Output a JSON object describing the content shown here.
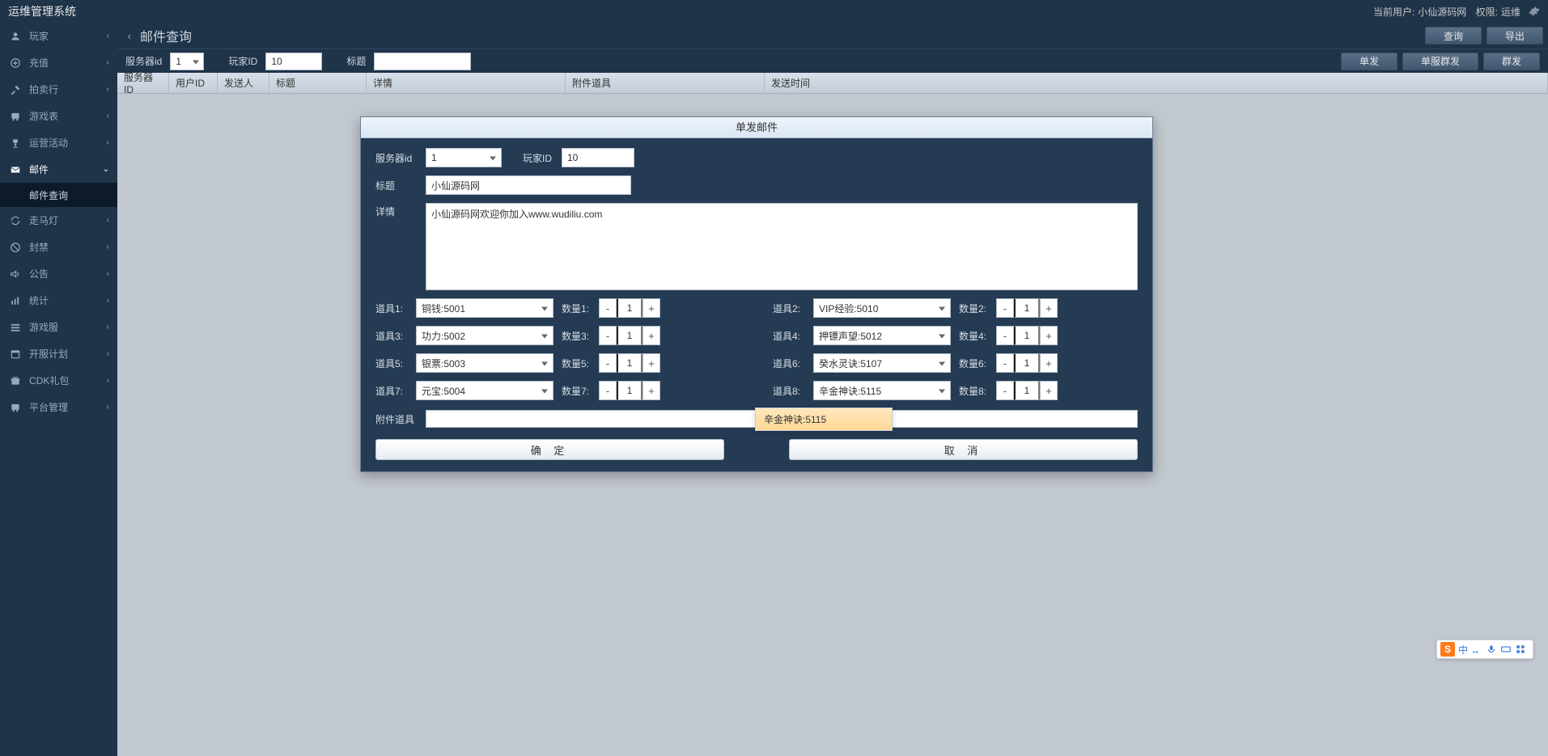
{
  "app": {
    "title": "运维管理系统"
  },
  "user": {
    "prefix": "当前用户:",
    "name": "小仙源码网",
    "role_prefix": "权限:",
    "role": "运维"
  },
  "sidebar": {
    "items": [
      {
        "label": "玩家",
        "icon": "user"
      },
      {
        "label": "充值",
        "icon": "gift"
      },
      {
        "label": "拍卖行",
        "icon": "hammer"
      },
      {
        "label": "游戏表",
        "icon": "bus"
      },
      {
        "label": "运营活动",
        "icon": "trophy"
      },
      {
        "label": "邮件",
        "icon": "mail",
        "expanded": true,
        "children": [
          {
            "label": "邮件查询"
          }
        ]
      },
      {
        "label": "走马灯",
        "icon": "refresh"
      },
      {
        "label": "封禁",
        "icon": "ban"
      },
      {
        "label": "公告",
        "icon": "horn"
      },
      {
        "label": "统计",
        "icon": "chart"
      },
      {
        "label": "游戏服",
        "icon": "list"
      },
      {
        "label": "开服计划",
        "icon": "calendar"
      },
      {
        "label": "CDK礼包",
        "icon": "gift2"
      },
      {
        "label": "平台管理",
        "icon": "bus"
      }
    ]
  },
  "page": {
    "title": "邮件查询",
    "actions_row1": {
      "query": "查询",
      "export": "导出"
    },
    "actions_row2": {
      "single": "单发",
      "server_single": "单服群发",
      "mass": "群发"
    },
    "filters": {
      "server_label": "服务器id",
      "server_value": "1",
      "player_label": "玩家ID",
      "player_value": "10",
      "title_label": "标题",
      "title_value": ""
    },
    "columns": {
      "c0": "服务器ID",
      "c1": "用户ID",
      "c2": "发送人",
      "c3": "标题",
      "c4": "详情",
      "c5": "附件道具",
      "c6": "发送时间"
    }
  },
  "modal": {
    "title": "单发邮件",
    "server_label": "服务器id",
    "server_value": "1",
    "player_label": "玩家ID",
    "player_value": "10",
    "subject_label": "标题",
    "subject_value": "小仙源码网",
    "detail_label": "详情",
    "detail_value": "小仙源码网欢迎你加入www.wudiliu.com",
    "items": [
      {
        "ilabel": "道具1:",
        "ivalue": "铜钱:5001",
        "qlabel": "数量1:",
        "qty": "1"
      },
      {
        "ilabel": "道具2:",
        "ivalue": "VIP经验:5010",
        "qlabel": "数量2:",
        "qty": "1"
      },
      {
        "ilabel": "道具3:",
        "ivalue": "功力:5002",
        "qlabel": "数量3:",
        "qty": "1"
      },
      {
        "ilabel": "道具4:",
        "ivalue": "押镖声望:5012",
        "qlabel": "数量4:",
        "qty": "1"
      },
      {
        "ilabel": "道具5:",
        "ivalue": "银票:5003",
        "qlabel": "数量5:",
        "qty": "1"
      },
      {
        "ilabel": "道具6:",
        "ivalue": "癸水灵诀:5107",
        "qlabel": "数量6:",
        "qty": "1"
      },
      {
        "ilabel": "道具7:",
        "ivalue": "元宝:5004",
        "qlabel": "数量7:",
        "qty": "1"
      },
      {
        "ilabel": "道具8:",
        "ivalue": "辛金神诀:5115",
        "qlabel": "数量8:",
        "qty": "1"
      }
    ],
    "attach_label": "附件道具",
    "dropdown_option": "辛金神诀:5115",
    "ok": "确 定",
    "cancel": "取 消"
  },
  "ime": {
    "lang": "中"
  }
}
